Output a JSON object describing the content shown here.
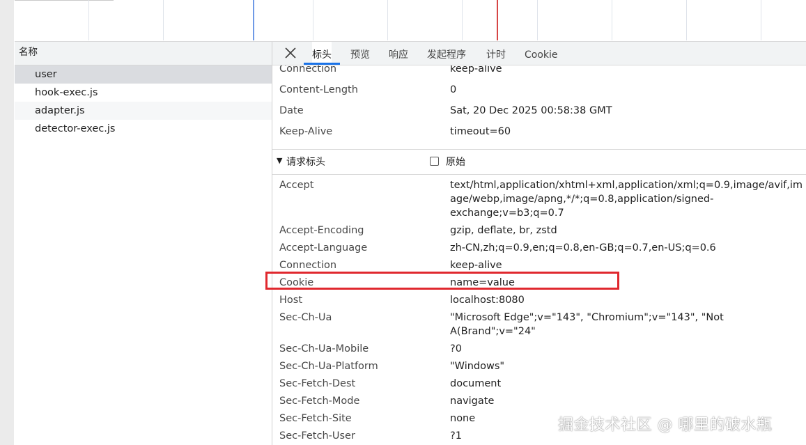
{
  "request_list": {
    "header": "名称",
    "items": [
      "user",
      "hook-exec.js",
      "adapter.js",
      "detector-exec.js"
    ],
    "selected_index": 0
  },
  "tabs": [
    "标头",
    "预览",
    "响应",
    "发起程序",
    "计时",
    "Cookie"
  ],
  "active_tab": "标头",
  "response_headers": [
    {
      "name": "Connection",
      "value": "keep-alive"
    },
    {
      "name": "Content-Length",
      "value": "0"
    },
    {
      "name": "Date",
      "value": "Sat, 20 Dec 2025 00:58:38 GMT"
    },
    {
      "name": "Keep-Alive",
      "value": "timeout=60"
    }
  ],
  "request_section": {
    "title": "请求标头",
    "raw_label": "原始",
    "raw_checked": false
  },
  "request_headers": [
    {
      "name": "Accept",
      "value_lines": [
        "text/html,application/xhtml+xml,application/xml;q=0.9,image/avif,im",
        "age/webp,image/apng,*/*;q=0.8,application/signed-",
        "exchange;v=b3;q=0.7"
      ]
    },
    {
      "name": "Accept-Encoding",
      "value_lines": [
        "gzip, deflate, br, zstd"
      ]
    },
    {
      "name": "Accept-Language",
      "value_lines": [
        "zh-CN,zh;q=0.9,en;q=0.8,en-GB;q=0.7,en-US;q=0.6"
      ]
    },
    {
      "name": "Connection",
      "value_lines": [
        "keep-alive"
      ]
    },
    {
      "name": "Cookie",
      "value_lines": [
        "name=value"
      ]
    },
    {
      "name": "Host",
      "value_lines": [
        "localhost:8080"
      ]
    },
    {
      "name": "Sec-Ch-Ua",
      "value_lines": [
        "\"Microsoft Edge\";v=\"143\", \"Chromium\";v=\"143\", \"Not",
        "A(Brand\";v=\"24\""
      ]
    },
    {
      "name": "Sec-Ch-Ua-Mobile",
      "value_lines": [
        "?0"
      ]
    },
    {
      "name": "Sec-Ch-Ua-Platform",
      "value_lines": [
        "\"Windows\""
      ]
    },
    {
      "name": "Sec-Fetch-Dest",
      "value_lines": [
        "document"
      ]
    },
    {
      "name": "Sec-Fetch-Mode",
      "value_lines": [
        "navigate"
      ]
    },
    {
      "name": "Sec-Fetch-Site",
      "value_lines": [
        "none"
      ]
    },
    {
      "name": "Sec-Fetch-User",
      "value_lines": [
        "?1"
      ]
    }
  ],
  "watermark": "掘金技术社区 @ 哪里的破水瓶",
  "colors": {
    "accent": "#1a73e8",
    "highlight": "#e0282e",
    "timeline_blue": "#6f9ae6",
    "timeline_red": "#d64545"
  }
}
